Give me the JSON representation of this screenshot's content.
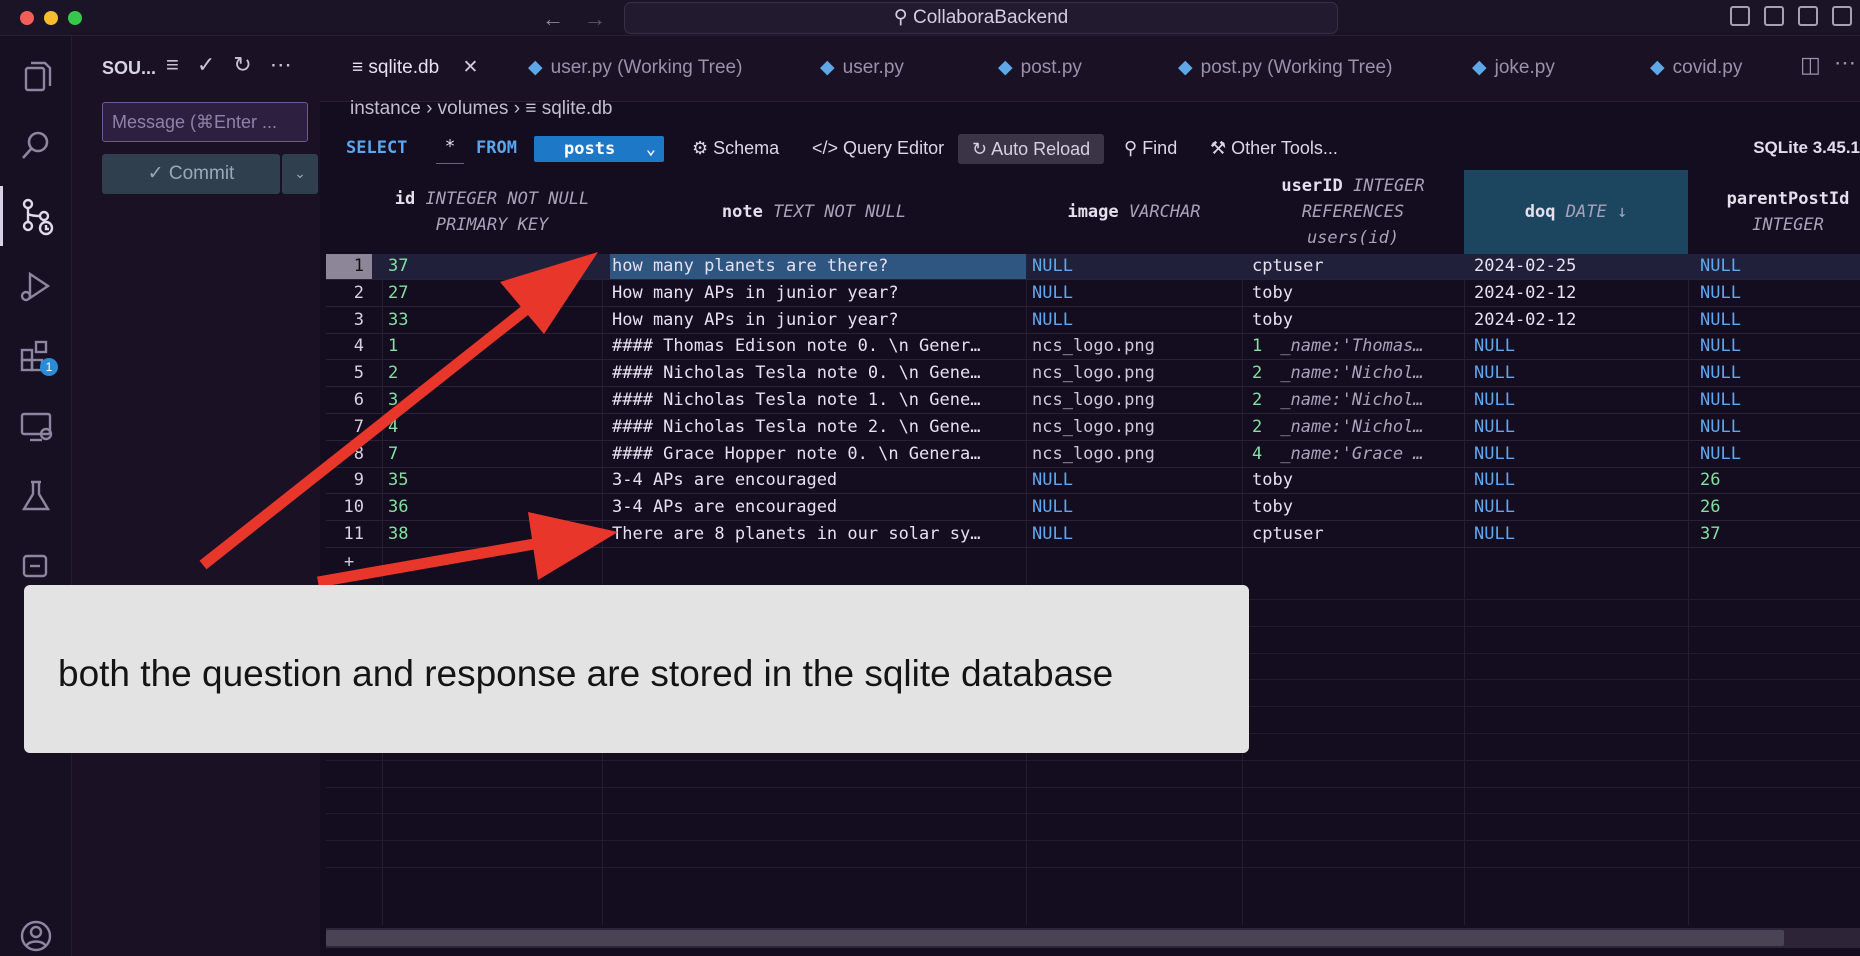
{
  "window": {
    "title": "CollaboraBackend"
  },
  "sidebar": {
    "title": "SOU...",
    "message_placeholder": "Message (⌘Enter ...",
    "commit_label": "✓ Commit",
    "badge_count": "1"
  },
  "tabs": [
    {
      "label": "sqlite.db",
      "kind": "db"
    },
    {
      "label": "user.py (Working Tree)",
      "kind": "py"
    },
    {
      "label": "user.py",
      "kind": "py"
    },
    {
      "label": "post.py",
      "kind": "py"
    },
    {
      "label": "post.py (Working Tree)",
      "kind": "py"
    },
    {
      "label": "joke.py",
      "kind": "py"
    },
    {
      "label": "covid.py",
      "kind": "py"
    }
  ],
  "breadcrumb": {
    "part1": "instance",
    "part2": "volumes",
    "part3": "sqlite.db"
  },
  "toolbar": {
    "select_kw": "SELECT",
    "star": "*",
    "from_kw": "FROM",
    "table": "posts",
    "schema": "Schema",
    "query_editor": "Query Editor",
    "auto_reload": "Auto Reload",
    "find": "Find",
    "other_tools": "Other Tools...",
    "version": "SQLite 3.45.1"
  },
  "columns": {
    "id": {
      "name": "id",
      "type1": "INTEGER NOT NULL",
      "type2": "PRIMARY KEY"
    },
    "note": {
      "name": "note",
      "type1": "TEXT NOT NULL"
    },
    "image": {
      "name": "image",
      "type1": "VARCHAR"
    },
    "userID": {
      "name": "userID",
      "type1": "INTEGER",
      "type2": "REFERENCES",
      "type3": "users(id)"
    },
    "doq": {
      "name": "doq",
      "type1": "DATE ↓"
    },
    "parentPostId": {
      "name": "parentPostId",
      "type1": "INTEGER"
    }
  },
  "rows": [
    {
      "n": "1",
      "id": "37",
      "note": "how many planets are there?",
      "image": "NULL",
      "user": "cptuser",
      "user_id": "",
      "doq": "2024-02-25",
      "parent": "NULL"
    },
    {
      "n": "2",
      "id": "27",
      "note": "How many APs in junior year?",
      "image": "NULL",
      "user": "toby",
      "user_id": "",
      "doq": "2024-02-12",
      "parent": "NULL"
    },
    {
      "n": "3",
      "id": "33",
      "note": "How many APs in junior year?",
      "image": "NULL",
      "user": "toby",
      "user_id": "",
      "doq": "2024-02-12",
      "parent": "NULL"
    },
    {
      "n": "4",
      "id": "1",
      "note": "#### Thomas Edison note 0. \\n Gener…",
      "image": "ncs_logo.png",
      "user": "_name:'Thomas…",
      "user_id": "1",
      "doq": "NULL",
      "parent": "NULL"
    },
    {
      "n": "5",
      "id": "2",
      "note": "#### Nicholas Tesla note 0. \\n Gene…",
      "image": "ncs_logo.png",
      "user": "_name:'Nichol…",
      "user_id": "2",
      "doq": "NULL",
      "parent": "NULL"
    },
    {
      "n": "6",
      "id": "3",
      "note": "#### Nicholas Tesla note 1. \\n Gene…",
      "image": "ncs_logo.png",
      "user": "_name:'Nichol…",
      "user_id": "2",
      "doq": "NULL",
      "parent": "NULL"
    },
    {
      "n": "7",
      "id": "4",
      "note": "#### Nicholas Tesla note 2. \\n Gene…",
      "image": "ncs_logo.png",
      "user": "_name:'Nichol…",
      "user_id": "2",
      "doq": "NULL",
      "parent": "NULL"
    },
    {
      "n": "8",
      "id": "7",
      "note": "#### Grace Hopper note 0. \\n Genera…",
      "image": "ncs_logo.png",
      "user": "_name:'Grace …",
      "user_id": "4",
      "doq": "NULL",
      "parent": "NULL"
    },
    {
      "n": "9",
      "id": "35",
      "note": "3-4 APs are encouraged",
      "image": "NULL",
      "user": "toby",
      "user_id": "",
      "doq": "NULL",
      "parent": "26"
    },
    {
      "n": "10",
      "id": "36",
      "note": "3-4 APs are encouraged",
      "image": "NULL",
      "user": "toby",
      "user_id": "",
      "doq": "NULL",
      "parent": "26"
    },
    {
      "n": "11",
      "id": "38",
      "note": "There are 8 planets in our solar sy…",
      "image": "NULL",
      "user": "cptuser",
      "user_id": "",
      "doq": "NULL",
      "parent": "37"
    }
  ],
  "add_row": "+",
  "annotation": {
    "text": "both the question and response are stored in the sqlite database",
    "arrow_color": "#e8362b"
  }
}
